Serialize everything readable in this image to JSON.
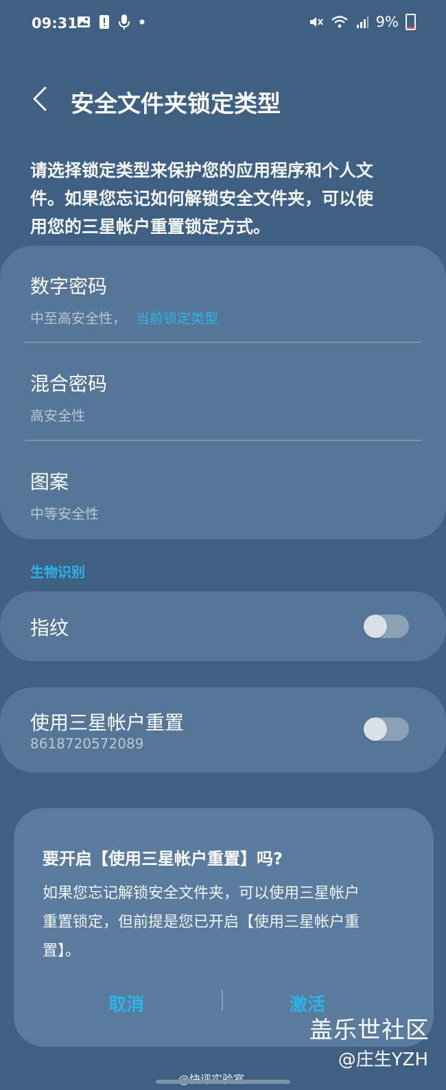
{
  "status_bar": {
    "time": "09:31",
    "battery": "9%",
    "left_icons": [
      "image-icon",
      "alert-icon",
      "mic-icon",
      "dot-icon"
    ],
    "right_icons": [
      "mute-icon",
      "wifi-icon",
      "signal-icon",
      "battery-icon"
    ]
  },
  "header": {
    "title": "安全文件夹锁定类型"
  },
  "description": {
    "lines": [
      "请选择锁定类型来保护您的应用程序和个人文",
      "件。如果您忘记如何解锁安全文件夹，可以使",
      "用您的三星帐户重置锁定方式。"
    ]
  },
  "lock_types": [
    {
      "title": "数字密码",
      "subtitle": "中至高安全性，",
      "current": "当前锁定类型"
    },
    {
      "title": "混合密码",
      "subtitle": "高安全性"
    },
    {
      "title": "图案",
      "subtitle": "中等安全性"
    }
  ],
  "biometrics": {
    "section_label": "生物识别",
    "fingerprint": {
      "label": "指纹",
      "enabled": false
    }
  },
  "samsung_reset": {
    "label": "使用三星帐户重置",
    "account": "8618720572089",
    "enabled": false
  },
  "dialog": {
    "title": "要开启【使用三星帐户重置】吗?",
    "body_lines": [
      "如果您忘记解锁安全文件夹，可以使用三星帐户",
      "重置锁定，但前提是您已开启【使用三星帐户重",
      "置】。"
    ],
    "cancel": "取消",
    "activate": "激活"
  },
  "watermark": {
    "community": "盖乐世社区",
    "author": "@庄生YZH",
    "source": "@快评实验室"
  },
  "colors": {
    "background": "#3f5f83",
    "card": "#567698",
    "accent": "#29b5e8",
    "dialog": "#5a7b9d"
  }
}
